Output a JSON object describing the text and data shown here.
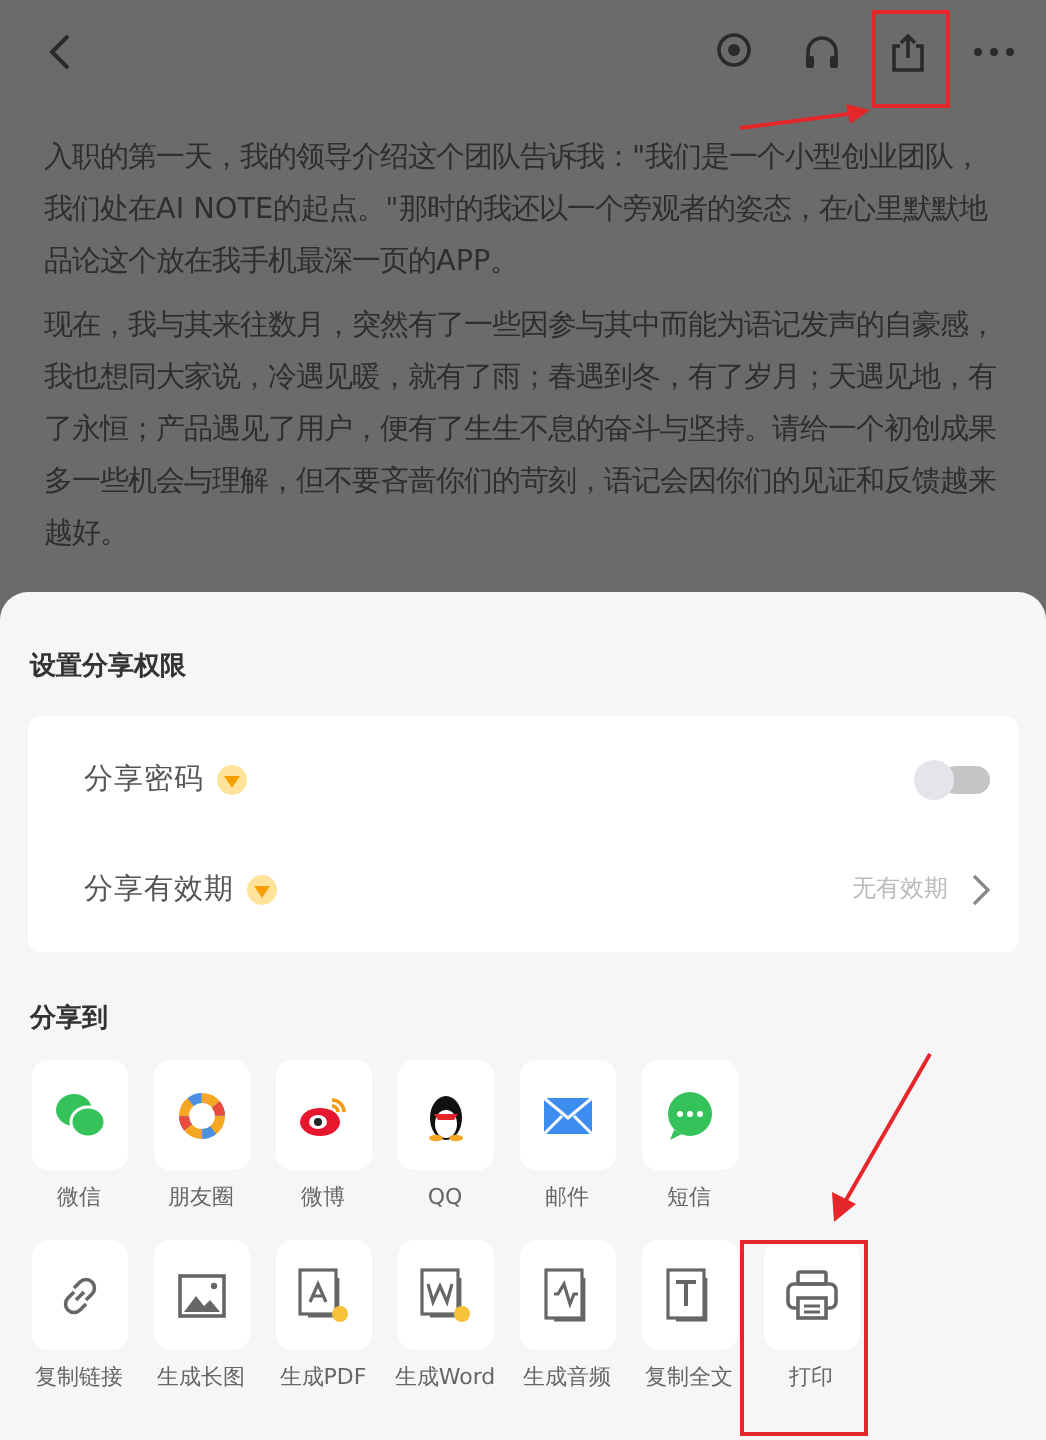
{
  "paragraphs": [
    "入职的第一天，我的领导介绍这个团队告诉我：\"我们是一个小型创业团队，我们处在AI NOTE的起点。\"那时的我还以一个旁观者的姿态，在心里默默地品论这个放在我手机最深一页的APP。",
    "现在，我与其来往数月，突然有了一些因参与其中而能为语记发声的自豪感，我也想同大家说，冷遇见暖，就有了雨；春遇到冬，有了岁月；天遇见地，有了永恒；产品遇见了用户，便有了生生不息的奋斗与坚持。请给一个初创成果多一些机会与理解，但不要吝啬你们的苛刻，语记会因你们的见证和反馈越来越好。"
  ],
  "share_sheet": {
    "title": "设置分享权限",
    "settings": [
      {
        "kind": "toggle",
        "label": "分享密码",
        "on": false
      },
      {
        "kind": "link",
        "label": "分享有效期",
        "value": "无有效期"
      }
    ],
    "share_title": "分享到",
    "rows": [
      [
        {
          "kind": "wechat",
          "label": "微信"
        },
        {
          "kind": "moments",
          "label": "朋友圈"
        },
        {
          "kind": "weibo",
          "label": "微博"
        },
        {
          "kind": "qq",
          "label": "QQ"
        },
        {
          "kind": "mail",
          "label": "邮件"
        },
        {
          "kind": "sms",
          "label": "短信"
        }
      ],
      [
        {
          "kind": "link",
          "label": "复制链接"
        },
        {
          "kind": "image",
          "label": "生成长图"
        },
        {
          "kind": "pdf",
          "label": "生成PDF"
        },
        {
          "kind": "word",
          "label": "生成Word"
        },
        {
          "kind": "audio",
          "label": "生成音频"
        },
        {
          "kind": "text",
          "label": "复制全文"
        },
        {
          "kind": "print",
          "label": "打印"
        }
      ]
    ]
  }
}
